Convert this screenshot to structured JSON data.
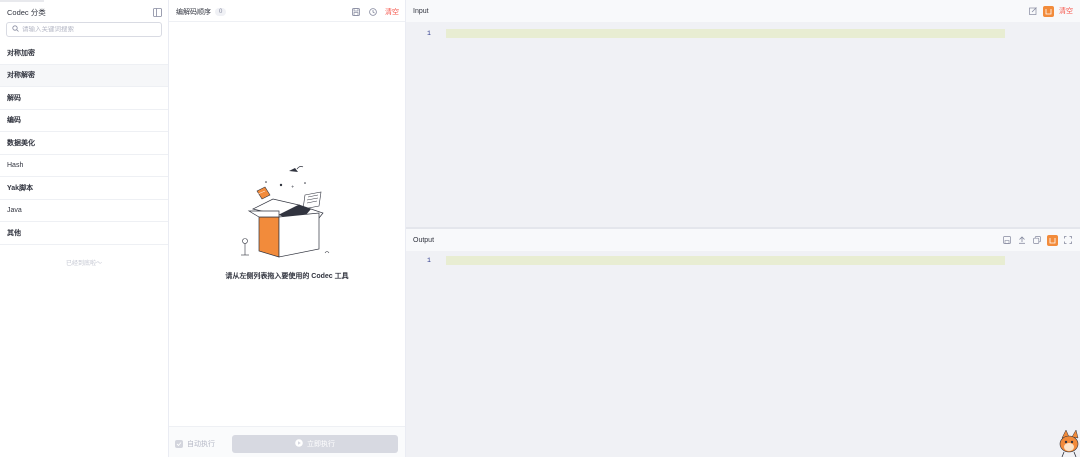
{
  "category_panel": {
    "title": "Codec 分类",
    "search_placeholder": "请输入关键词搜索",
    "items": [
      {
        "label": "对称加密"
      },
      {
        "label": "对称解密"
      },
      {
        "label": "解码"
      },
      {
        "label": "编码"
      },
      {
        "label": "数据美化"
      },
      {
        "label": "Hash"
      },
      {
        "label": "Yak脚本"
      },
      {
        "label": "Java"
      },
      {
        "label": "其他"
      }
    ],
    "end_text": "已经到底啦～"
  },
  "sequence_panel": {
    "title": "编解码顺序",
    "count": "0",
    "clear_label": "清空",
    "empty_text": "请从左侧列表拖入要使用的 Codec 工具",
    "auto_run_label": "自动执行",
    "run_label": "立即执行"
  },
  "input_editor": {
    "title": "Input",
    "clear_label": "清空",
    "line_number": "1"
  },
  "output_editor": {
    "title": "Output",
    "line_number": "1"
  },
  "colors": {
    "accent": "#f28b3b",
    "danger": "#f6544a",
    "line_highlight": "#e8edd2",
    "editor_bg": "#f0f1f5"
  }
}
